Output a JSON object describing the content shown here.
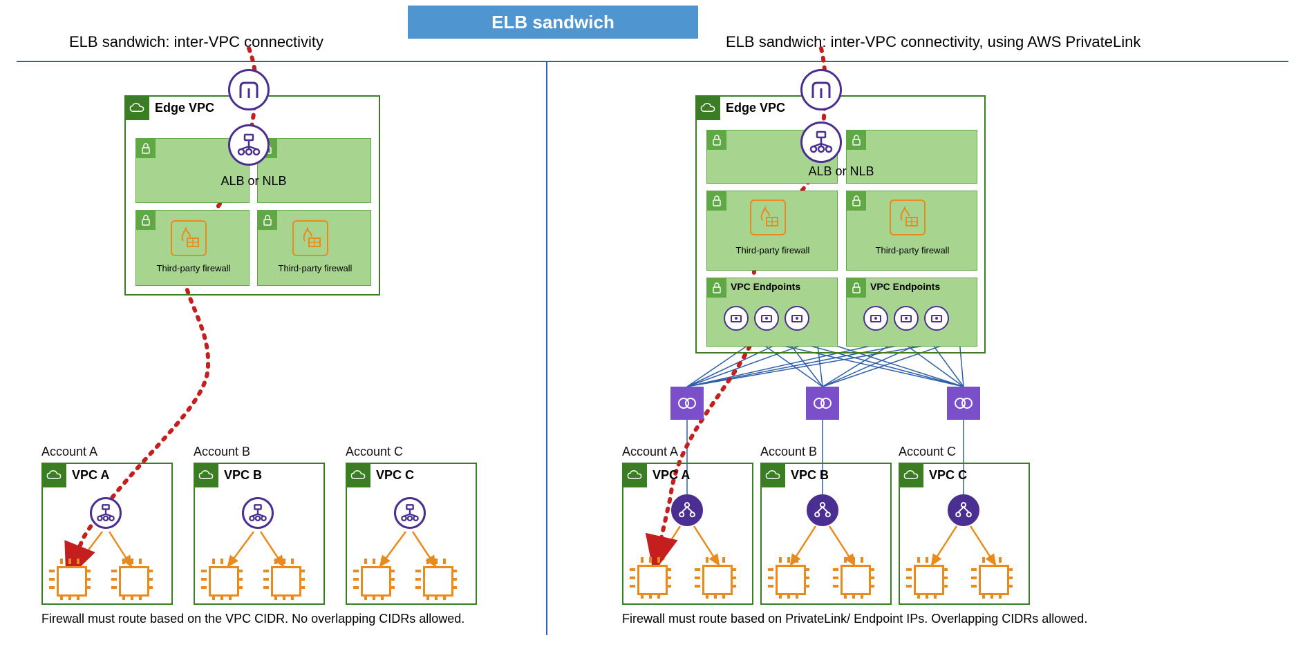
{
  "title": "ELB sandwich",
  "left": {
    "subtitle": "ELB sandwich: inter-VPC connectivity",
    "edge": {
      "label": "Edge VPC",
      "lb_text": "ALB or NLB",
      "fw_label": "Third-party firewall"
    },
    "accounts": {
      "a": {
        "name": "Account A",
        "vpc": "VPC A"
      },
      "b": {
        "name": "Account B",
        "vpc": "VPC B"
      },
      "c": {
        "name": "Account C",
        "vpc": "VPC C"
      }
    },
    "caption": "Firewall must route based on the VPC CIDR. No overlapping CIDRs allowed."
  },
  "right": {
    "subtitle": "ELB sandwich: inter-VPC connectivity, using AWS PrivateLink",
    "edge": {
      "label": "Edge VPC",
      "lb_text": "ALB or NLB",
      "fw_label": "Third-party firewall",
      "ep_label": "VPC Endpoints"
    },
    "accounts": {
      "a": {
        "name": "Account A",
        "vpc": "VPC A"
      },
      "b": {
        "name": "Account B",
        "vpc": "VPC B"
      },
      "c": {
        "name": "Account C",
        "vpc": "VPC C"
      }
    },
    "caption": "Firewall must route based on PrivateLink/ Endpoint IPs. Overlapping CIDRs allowed."
  }
}
